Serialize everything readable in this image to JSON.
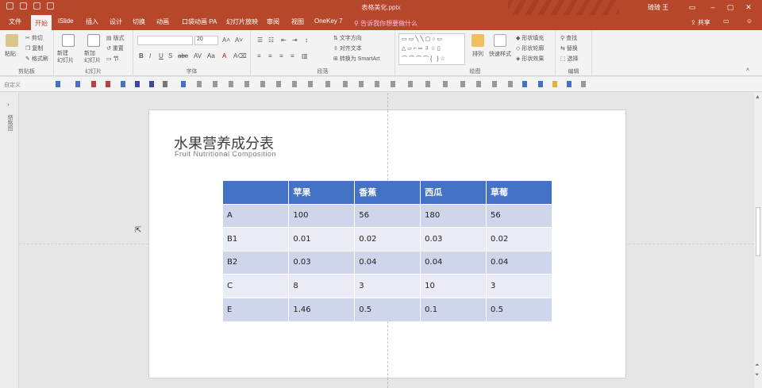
{
  "window": {
    "title": "表格美化.pptx",
    "user": "琦琦 王"
  },
  "tabs": [
    {
      "label": "文件"
    },
    {
      "label": "开始",
      "active": true
    },
    {
      "label": "iSlide"
    },
    {
      "label": "插入"
    },
    {
      "label": "设计"
    },
    {
      "label": "切换"
    },
    {
      "label": "动画"
    },
    {
      "label": "口袋动画 PA"
    },
    {
      "label": "幻灯片放映"
    },
    {
      "label": "审阅"
    },
    {
      "label": "视图"
    },
    {
      "label": "OneKey 7"
    }
  ],
  "tell_me": "告诉我你想要做什么",
  "share_label": "共享",
  "ribbon": {
    "clipboard": {
      "label": "剪贴板",
      "paste": "粘贴",
      "cut": "剪切",
      "copy": "复制",
      "format_painter": "格式刷"
    },
    "slides": {
      "label": "幻灯片",
      "new_slide": "新建\n幻灯片",
      "new_section": "新加\n幻灯片",
      "layout": "版式",
      "reset": "重置",
      "section": "节"
    },
    "font": {
      "label": "字体",
      "font_name": "",
      "font_size": "20"
    },
    "paragraph": {
      "label": "段落",
      "text_direction": "文字方向",
      "align_text": "对齐文本",
      "smartart": "转换为 SmartArt"
    },
    "drawing": {
      "label": "绘图",
      "arrange": "排列",
      "quick_styles": "快速样式",
      "shape_fill": "形状填充",
      "shape_outline": "形状轮廓",
      "shape_effects": "形状效果"
    },
    "editing": {
      "label": "编辑",
      "find": "查找",
      "replace": "替换",
      "select": "选择"
    }
  },
  "toolbar2": {
    "label": "自定义"
  },
  "left_pane": {
    "label": "缩略图"
  },
  "slide": {
    "title": "水果营养成分表",
    "subtitle": "Fruit Nutritional Composition",
    "table": {
      "headers": [
        "",
        "苹果",
        "香蕉",
        "西瓜",
        "草莓"
      ],
      "rows": [
        [
          "A",
          "100",
          "56",
          "180",
          "56"
        ],
        [
          "B1",
          "0.01",
          "0.02",
          "0.03",
          "0.02"
        ],
        [
          "B2",
          "0.03",
          "0.04",
          "0.04",
          "0.04"
        ],
        [
          "C",
          "8",
          "3",
          "10",
          "3"
        ],
        [
          "E",
          "1.46",
          "0.5",
          "0.1",
          "0.5"
        ]
      ]
    }
  },
  "colors": {
    "accent": "#b7472a",
    "table_header": "#4472c4",
    "row_odd": "#cfd5ea",
    "row_even": "#e9ebf5"
  }
}
